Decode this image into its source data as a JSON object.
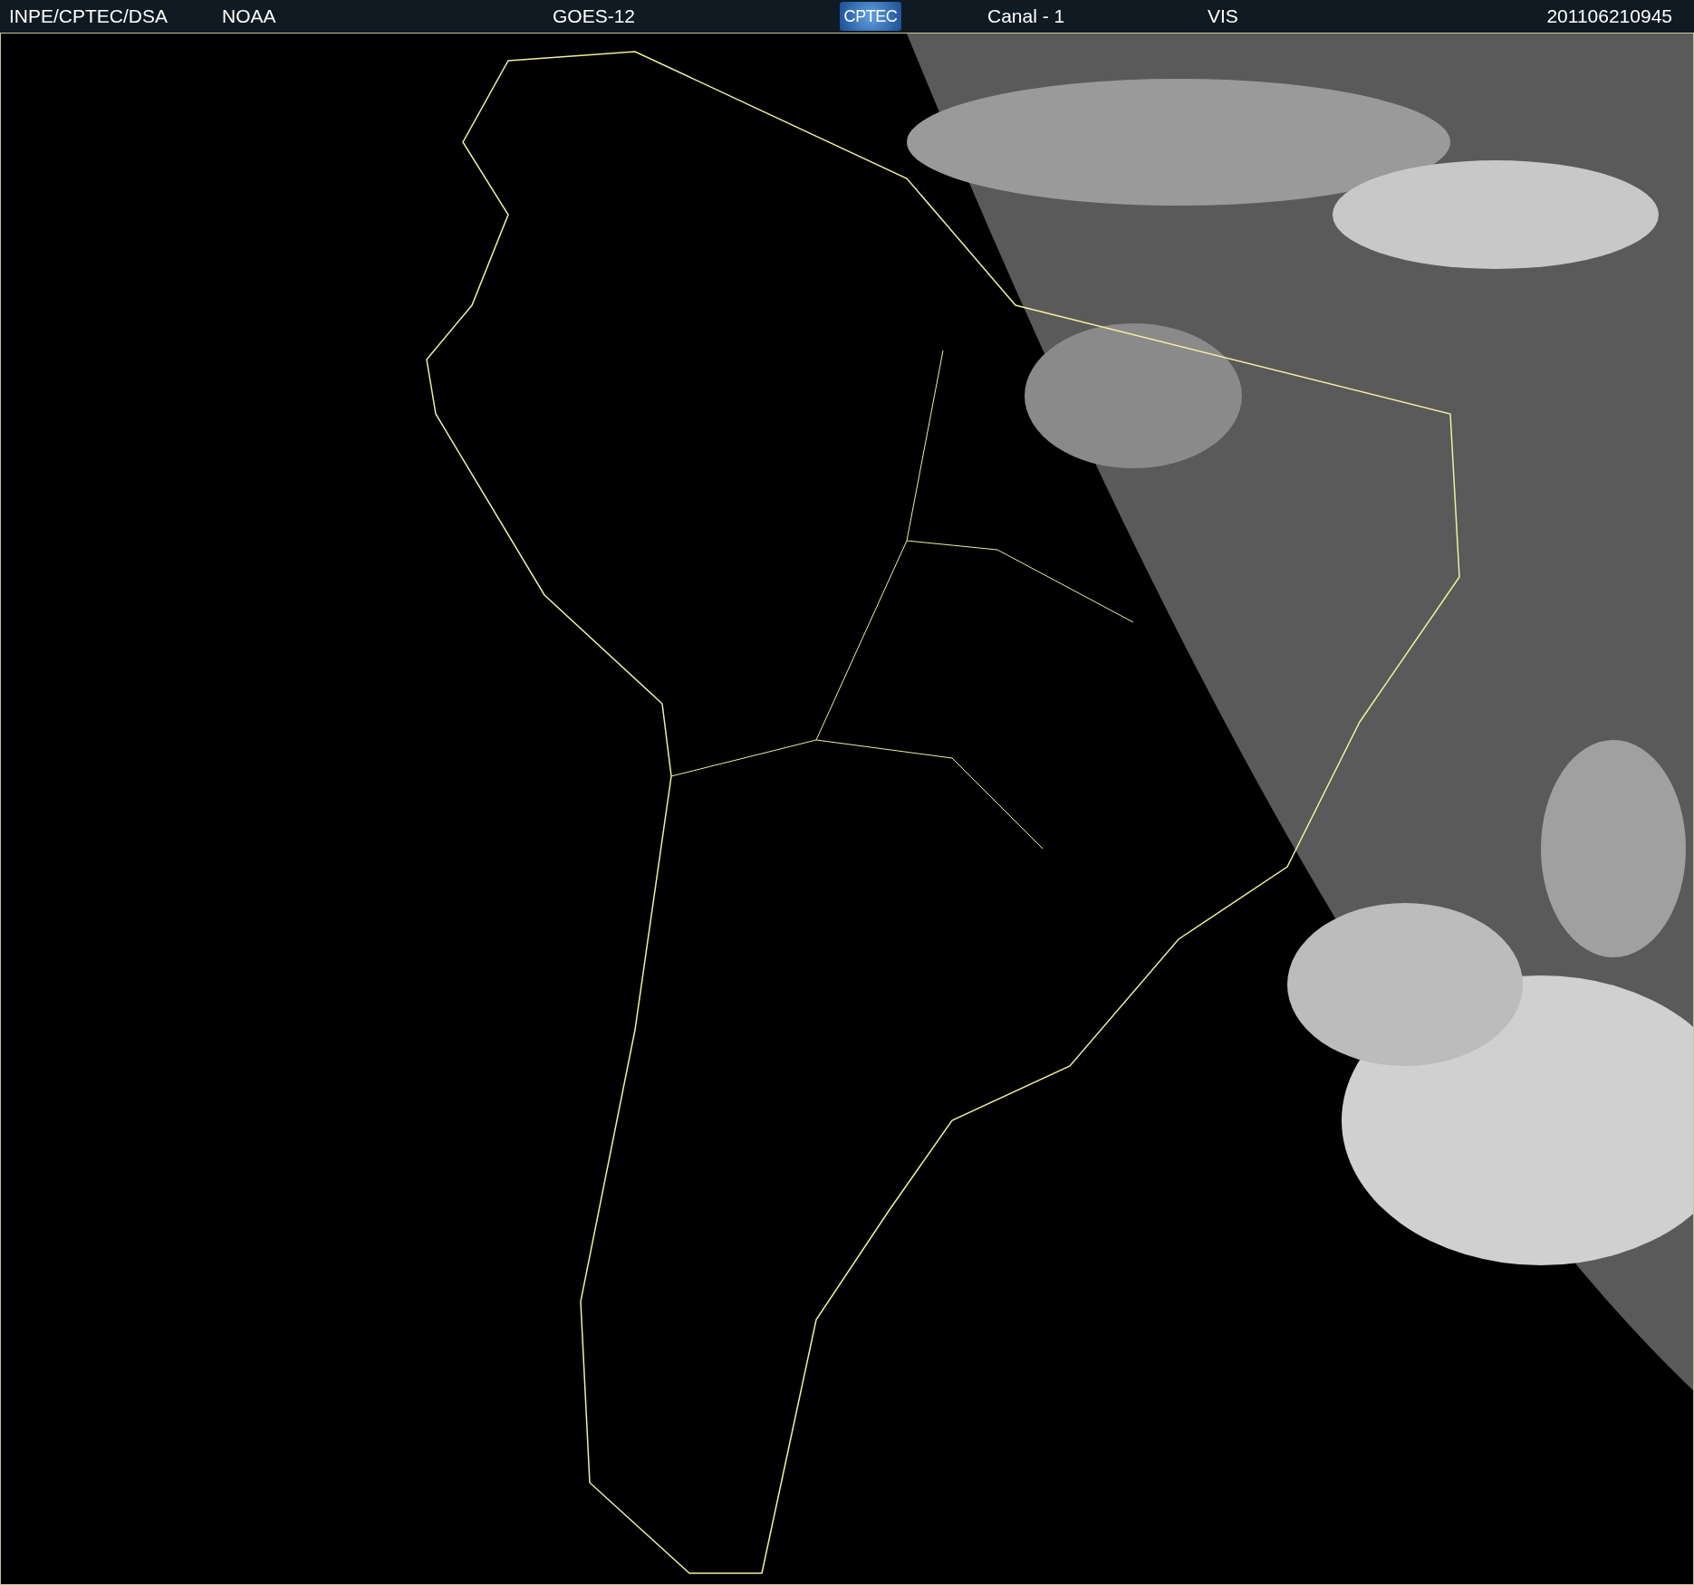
{
  "header": {
    "items": [
      {
        "kind": "text",
        "text": "INPE/CPTEC/DSA"
      },
      {
        "kind": "text",
        "text": "NOAA"
      },
      {
        "kind": "text",
        "text": "GOES-12"
      },
      {
        "kind": "logo",
        "text": "CPTEC"
      },
      {
        "kind": "text",
        "text": "Canal - 1"
      },
      {
        "kind": "text",
        "text": "VIS"
      },
      {
        "kind": "text",
        "text": "201106210945"
      }
    ]
  }
}
